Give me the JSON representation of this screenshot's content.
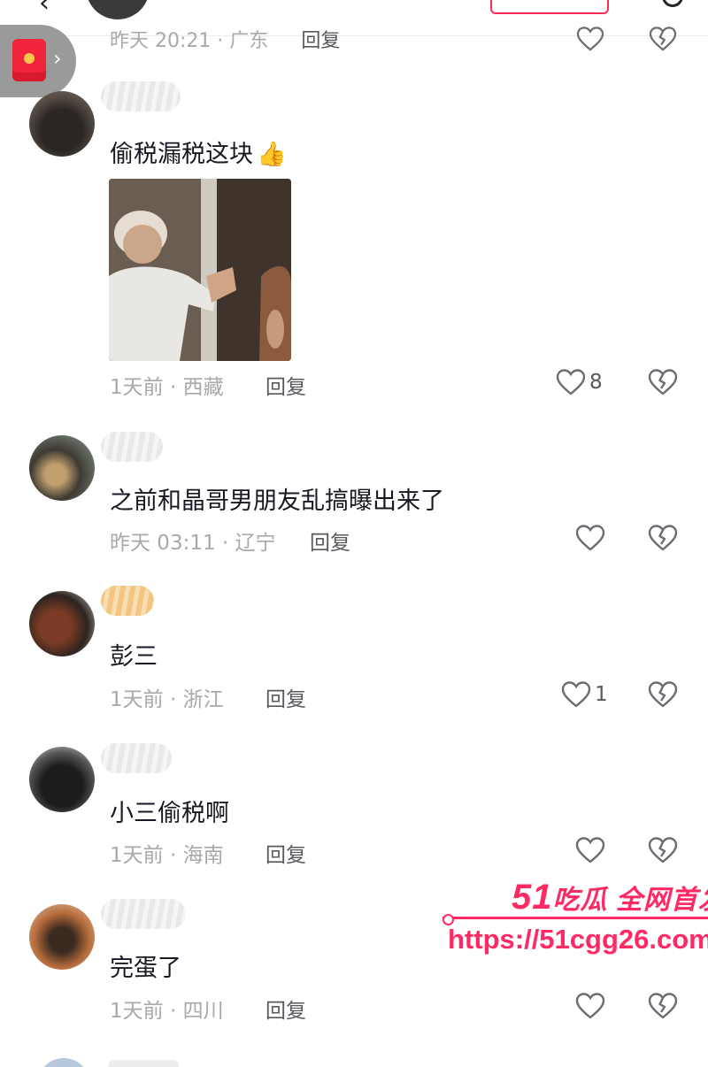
{
  "previous_comment": {
    "time_location": "昨天 20:21 · 广东",
    "reply_label": "回复"
  },
  "comments": [
    {
      "text": "偷税漏税这块",
      "emoji": "👍",
      "time": "1天前",
      "location": "西藏",
      "reply_label": "回复",
      "likes": "8"
    },
    {
      "text": "之前和晶哥男朋友乱搞曝出来了",
      "time": "昨天 03:11",
      "location": "辽宁",
      "reply_label": "回复",
      "likes": ""
    },
    {
      "text": "彭三",
      "time": "1天前",
      "location": "浙江",
      "reply_label": "回复",
      "likes": "1"
    },
    {
      "text": "小三偷税啊",
      "time": "1天前",
      "location": "海南",
      "reply_label": "回复",
      "likes": ""
    },
    {
      "text": "完蛋了",
      "time": "1天前",
      "location": "四川",
      "reply_label": "回复",
      "likes": ""
    }
  ],
  "icons": {
    "like": "heart-outline-icon",
    "dislike": "broken-heart-icon",
    "red_packet": "red-envelope-icon",
    "thumbs_up": "thumbs-up-emoji"
  },
  "watermark": {
    "brand_number": "51",
    "brand_text": "吃瓜 全网首发",
    "url": "https://51cgg26.com"
  },
  "colors": {
    "meta_gray": "#a8a8ad",
    "reply_gray": "#58585f",
    "accent": "#fe2c55",
    "watermark": "#ff2a63"
  }
}
